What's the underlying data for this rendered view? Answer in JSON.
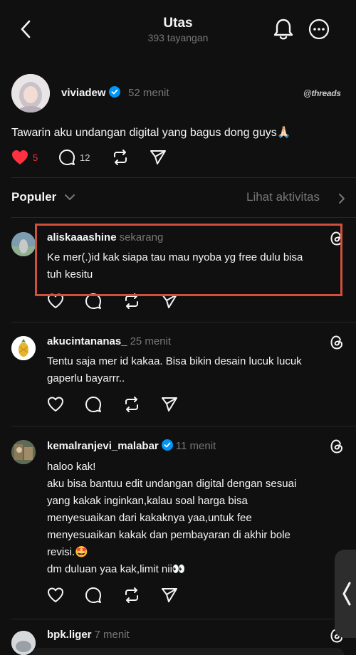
{
  "header": {
    "title": "Utas",
    "views": "393 tayangan"
  },
  "post": {
    "username": "viviadew",
    "time": "52 menit",
    "brand": "threads",
    "text": "Tawarin aku undangan digital yang bagus dong guys🙏🏻",
    "like_count": "5",
    "reply_count": "12"
  },
  "sort": {
    "label": "Populer",
    "activity_label": "Lihat aktivitas"
  },
  "comments": [
    {
      "username": "aliskaaashine",
      "time": "sekarang",
      "lines": [
        "Ke mer(.)id kak siapa tau mau nyoba yg free dulu bisa",
        "tuh kesitu"
      ]
    },
    {
      "username": "akucintananas_",
      "time": "25 menit",
      "lines": [
        "Tentu saja mer id kakaa. Bisa bikin desain lucuk lucuk",
        "gaperlu bayarrr.."
      ]
    },
    {
      "username": "kemalranjevi_malabar",
      "time": "11 menit",
      "lines": [
        "haloo kak!",
        "aku bisa bantuu edit undangan digital dengan sesuai",
        "yang kakak inginkan,kalau soal harga bisa",
        "menyesuaikan dari kakaknya yaa,untuk fee",
        "menyesuaikan kakak dan pembayaran di akhir bole",
        "revisi.🤩",
        "dm duluan yaa kak,limit nii👀"
      ]
    },
    {
      "username": "bpk.liger",
      "time": "7 menit",
      "lines": []
    }
  ],
  "colors": {
    "background": "#101010",
    "text": "#f3f5f7",
    "muted": "#777777",
    "like_red": "#ff3040",
    "verified_blue": "#0095f6",
    "highlight": "#d0503b"
  },
  "icons": [
    "back-arrow-icon",
    "bell-icon",
    "more-icon",
    "verified-icon",
    "heart-icon",
    "comment-icon",
    "repost-icon",
    "share-icon",
    "threads-icon",
    "chevron-down-icon",
    "chevron-right-icon",
    "chevron-left-icon"
  ]
}
